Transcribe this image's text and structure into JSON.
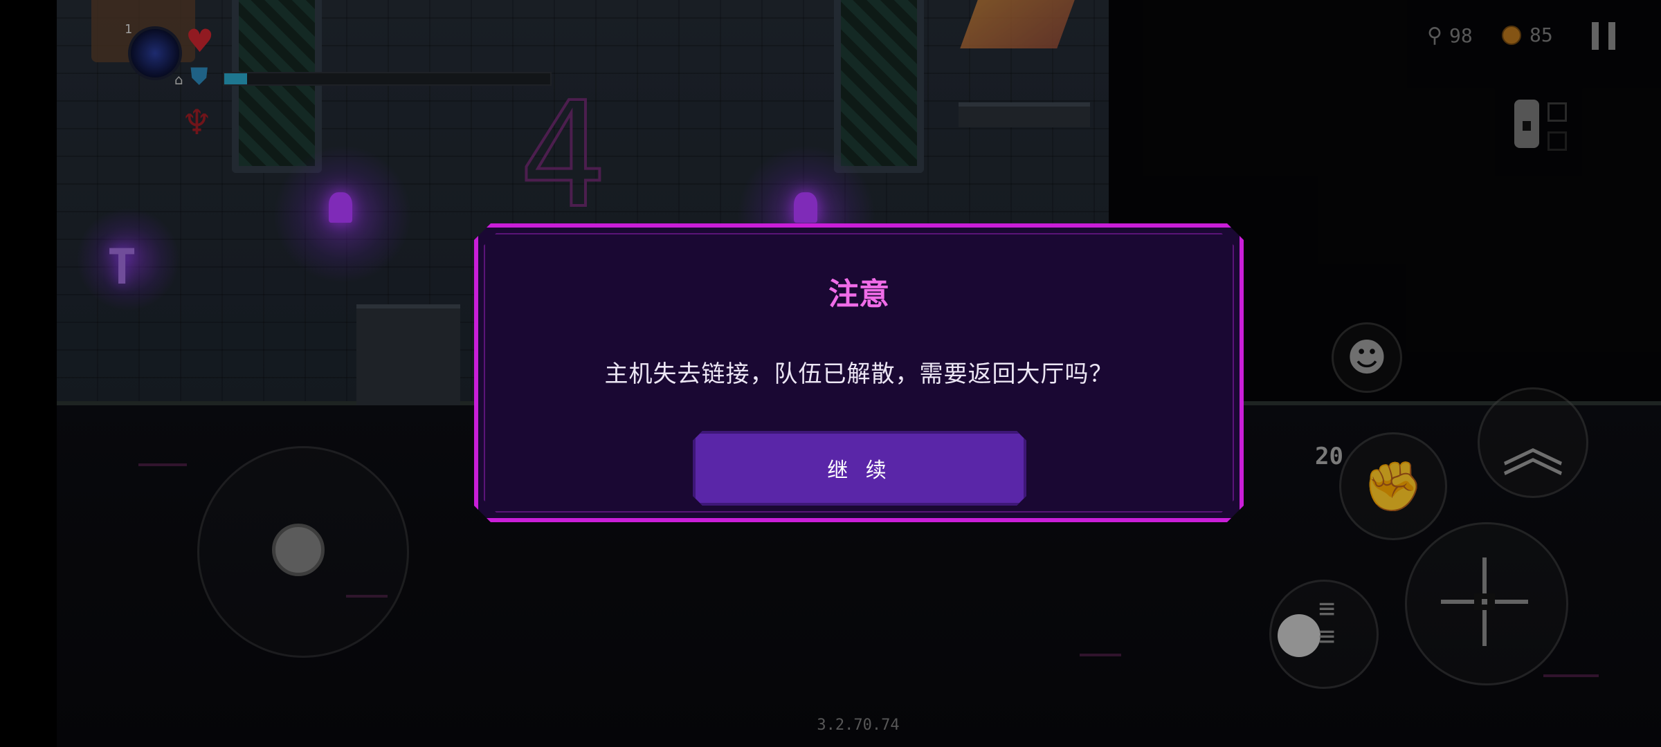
{
  "dialog": {
    "title": "注意",
    "message": "主机失去链接，队伍已解散，需要返回大厅吗？",
    "continue_label": "继 续"
  },
  "hud": {
    "avatar_level": "1",
    "gems": "98",
    "coins": "85",
    "mp_fill_fraction": 0.07,
    "skill_count": "20"
  },
  "scene": {
    "room_number": "4",
    "sign_glyph": "T"
  },
  "version": "3.2.70.74",
  "icons": {
    "heart": "heart-icon",
    "shield": "shield-icon",
    "home": "home-icon",
    "demon": "demon-icon",
    "gem": "gem-icon",
    "coin": "coin-icon",
    "pause": "pause-icon",
    "emote": "emote-icon",
    "jump": "double-chevron-up-icon",
    "attack": "crosshair-icon",
    "dash": "dash-icon",
    "skill": "fist-icon"
  },
  "colors": {
    "dialog_border": "#c91ed8",
    "dialog_bg": "#1a0833",
    "dialog_title": "#f06ce8",
    "button_bg": "#5a26a8"
  }
}
